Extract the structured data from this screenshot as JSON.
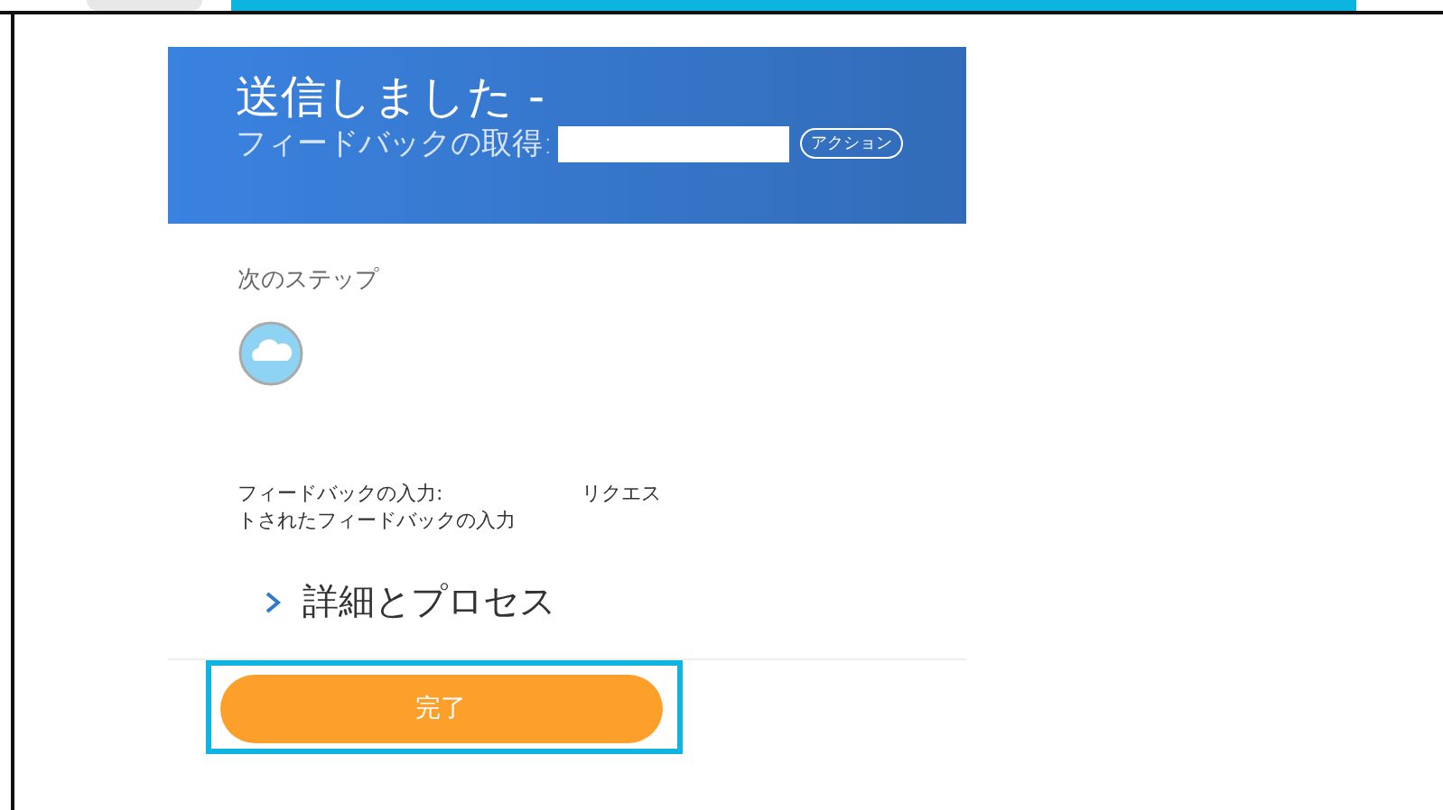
{
  "header": {
    "title": "送信しました -",
    "subtitle": "フィードバックの取得:",
    "action_button": "アクション"
  },
  "next_steps": {
    "heading": "次のステップ",
    "description": "フィードバックの入力:　　　　　　　リクエストされたフィードバックの入力"
  },
  "details": {
    "label": "詳細とプロセス",
    "expanded": false
  },
  "done_button": {
    "label": "完了",
    "highlighted": true
  }
}
